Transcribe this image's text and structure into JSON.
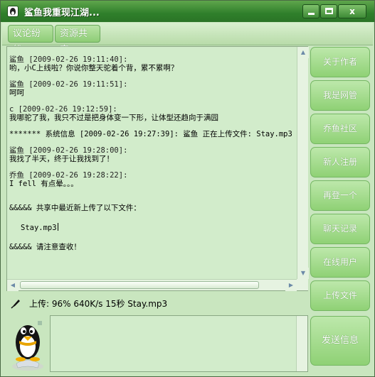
{
  "window": {
    "title": "鲨鱼我重现江湖..."
  },
  "titlebar_buttons": {
    "close_label": "x"
  },
  "top_tabs": [
    {
      "label": "议论纷纷"
    },
    {
      "label": "资源共享"
    }
  ],
  "chat": {
    "messages": [
      {
        "header": "鲨鱼 [2009-02-26 19:11:40]:",
        "body": "哟，小C上线啦？你说你整天驼着个背，累不累啊？"
      },
      {
        "header": "鲨鱼 [2009-02-26 19:11:51]:",
        "body": "呵呵"
      },
      {
        "header": "c [2009-02-26 19:12:59]:",
        "body": "我哪驼了我，我只不过是把身体变一下形，让体型还趋向于满园"
      }
    ],
    "system_line": "******* 系统信息 [2009-02-26 19:27:39]: 鲨鱼 正在上传文件: Stay.mp3",
    "messages2": [
      {
        "header": "鲨鱼 [2009-02-26 19:28:00]:",
        "body": "我找了半天，终于让我找到了！"
      },
      {
        "header": "乔鱼 [2009-02-26 19:28:22]:",
        "body": "I fell 有点晕。。。"
      }
    ],
    "share_head": "&&&&& 共享中最近新上传了以下文件：",
    "share_file": "Stay.mp3",
    "share_tail": "&&&&& 请注意查收！"
  },
  "upload_status": "上传: 96%  640K/s  15秒  Stay.mp3",
  "side_buttons": {
    "about": "关于作者",
    "admin": "我是网管",
    "community": "乔鱼社区",
    "register": "新人注册",
    "relogin": "再登一个",
    "history": "聊天记录",
    "online": "在线用户",
    "upload": "上传文件",
    "send": "发送信息"
  },
  "colors": {
    "accent": "#8fd175",
    "titlebar": "#2f7f2b",
    "panel": "#d2eccb"
  },
  "icons": {
    "app": "penguin-icon",
    "upload": "quill-icon",
    "avatar": "penguin-avatar"
  }
}
